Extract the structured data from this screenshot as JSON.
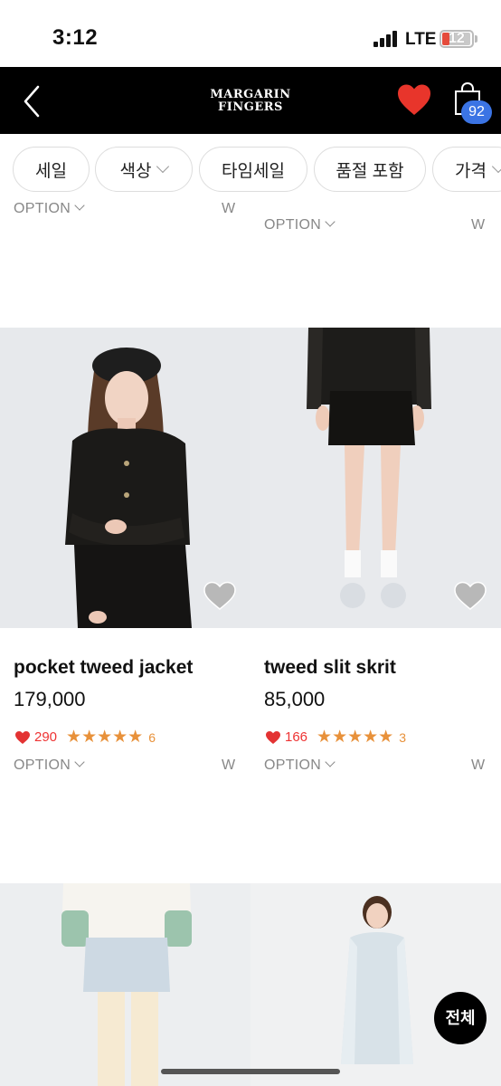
{
  "status": {
    "time": "3:12",
    "network": "LTE",
    "battery": "12"
  },
  "header": {
    "brand_line1": "MARGARIN",
    "brand_line2": "FINGERS",
    "cart_count": "92"
  },
  "filters": [
    {
      "label": "세일",
      "dropdown": false
    },
    {
      "label": "색상",
      "dropdown": true
    },
    {
      "label": "타임세일",
      "dropdown": false
    },
    {
      "label": "품절 포함",
      "dropdown": false
    },
    {
      "label": "가격",
      "dropdown": true
    }
  ],
  "top_row": {
    "left": {
      "option_label": "OPTION",
      "w_label": "W"
    },
    "right": {
      "option_label": "OPTION",
      "w_label": "W"
    }
  },
  "products": [
    {
      "name": "pocket tweed jacket",
      "price": "179,000",
      "likes": "290",
      "stars": "★★★★★",
      "rating": 4.5,
      "reviews": "6",
      "option_label": "OPTION",
      "w_label": "W"
    },
    {
      "name": "tweed slit skrit",
      "price": "85,000",
      "likes": "166",
      "stars": "★★★★★",
      "rating": 5,
      "reviews": "3",
      "option_label": "OPTION",
      "w_label": "W"
    }
  ],
  "fab": {
    "label": "전체"
  },
  "colors": {
    "header_bg": "#000000",
    "heart": "#e8352b",
    "badge": "#3b74e4",
    "star": "#e8913a",
    "like": "#e33333"
  }
}
